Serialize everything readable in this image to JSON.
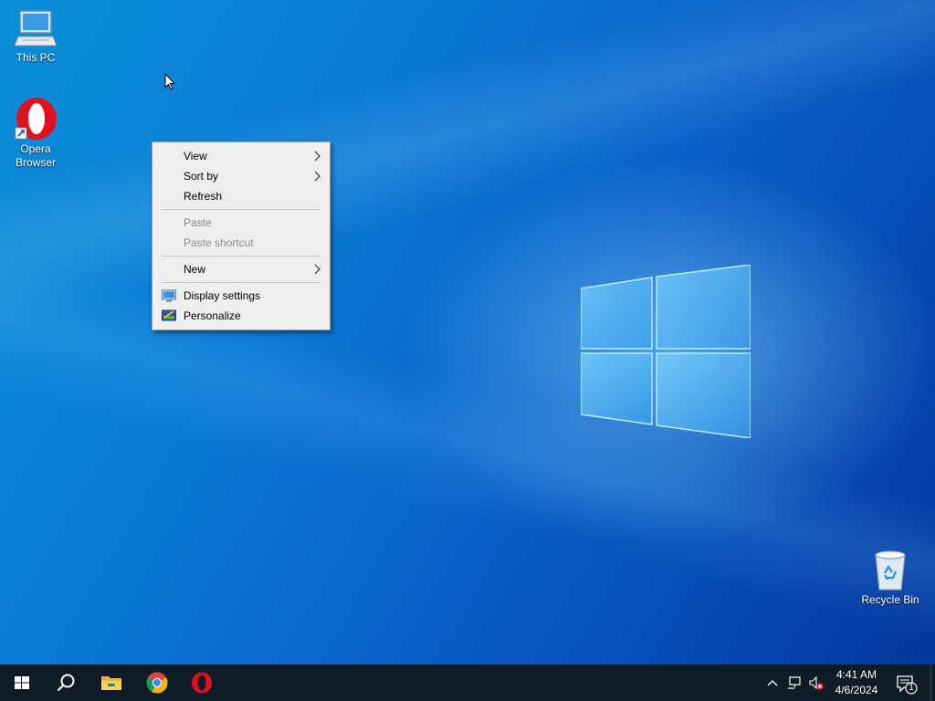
{
  "desktop": {
    "icons": [
      {
        "label_line1": "This PC",
        "label_line2": ""
      },
      {
        "label_line1": "Opera",
        "label_line2": "Browser"
      },
      {
        "label_line1": "Recycle Bin",
        "label_line2": ""
      }
    ]
  },
  "context_menu": {
    "items": [
      {
        "label": "View",
        "submenu": true,
        "enabled": true
      },
      {
        "label": "Sort by",
        "submenu": true,
        "enabled": true
      },
      {
        "label": "Refresh",
        "submenu": false,
        "enabled": true
      },
      {
        "label": "Paste",
        "submenu": false,
        "enabled": false
      },
      {
        "label": "Paste shortcut",
        "submenu": false,
        "enabled": false
      },
      {
        "label": "New",
        "submenu": true,
        "enabled": true
      },
      {
        "label": "Display settings",
        "submenu": false,
        "enabled": true,
        "icon": "display-icon"
      },
      {
        "label": "Personalize",
        "submenu": false,
        "enabled": true,
        "icon": "personalize-icon"
      }
    ]
  },
  "taskbar": {
    "apps": [
      {
        "icon": "windows-start-icon"
      },
      {
        "icon": "search-icon"
      },
      {
        "icon": "file-explorer-icon"
      },
      {
        "icon": "chrome-icon"
      },
      {
        "icon": "opera-icon"
      }
    ],
    "tray": {
      "icons": [
        "chevron-up-icon",
        "network-icon",
        "volume-muted-icon"
      ],
      "time": "4:41 AM",
      "date": "4/6/2024",
      "notification_count": "1"
    }
  },
  "colors": {
    "taskbar": "#0f1b26",
    "desktop_accent": "#0b78d4",
    "menu_background": "#eeeeee",
    "opera_red": "#e0111f"
  }
}
